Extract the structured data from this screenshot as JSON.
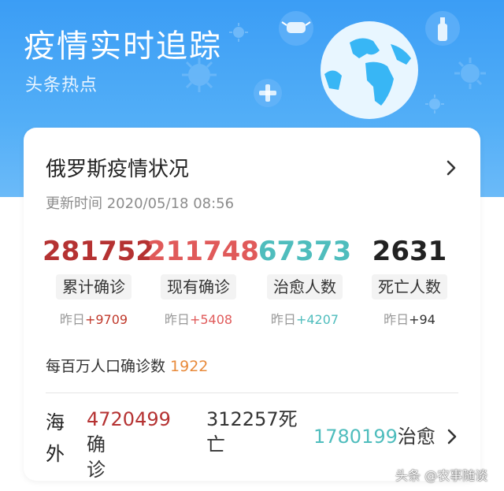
{
  "header": {
    "title": "疫情实时追踪",
    "subtitle": "头条热点"
  },
  "card": {
    "title": "俄罗斯疫情状况",
    "update_time": "更新时间 2020/05/18 08:56",
    "stats": [
      {
        "value": "281752",
        "label": "累计确诊",
        "delta_prefix": "昨日",
        "delta": "+9709",
        "color": "#b53232",
        "delta_color": "#c0392b"
      },
      {
        "value": "211748",
        "label": "现有确诊",
        "delta_prefix": "昨日",
        "delta": "+5408",
        "color": "#e05a5a",
        "delta_color": "#e05a5a"
      },
      {
        "value": "67373",
        "label": "治愈人数",
        "delta_prefix": "昨日",
        "delta": "+4207",
        "color": "#4fbdbd",
        "delta_color": "#4fbdbd"
      },
      {
        "value": "2631",
        "label": "死亡人数",
        "delta_prefix": "昨日",
        "delta": "+94",
        "color": "#222222",
        "delta_color": "#333333"
      }
    ],
    "per_million_label": "每百万人口确诊数",
    "per_million_value": "1922",
    "overseas": {
      "label": "海外",
      "confirmed_num": "4720499",
      "confirmed_unit_a": "确",
      "confirmed_unit_b": "诊",
      "deaths_num": "312257",
      "deaths_unit_a": "死",
      "deaths_unit_b": "亡",
      "cured_num": "1780199",
      "cured_unit": "治愈"
    }
  },
  "watermark": "头条 @农事随谈",
  "colors": {
    "header_top": "#3b9df5",
    "header_bottom": "#6bbaf8"
  }
}
